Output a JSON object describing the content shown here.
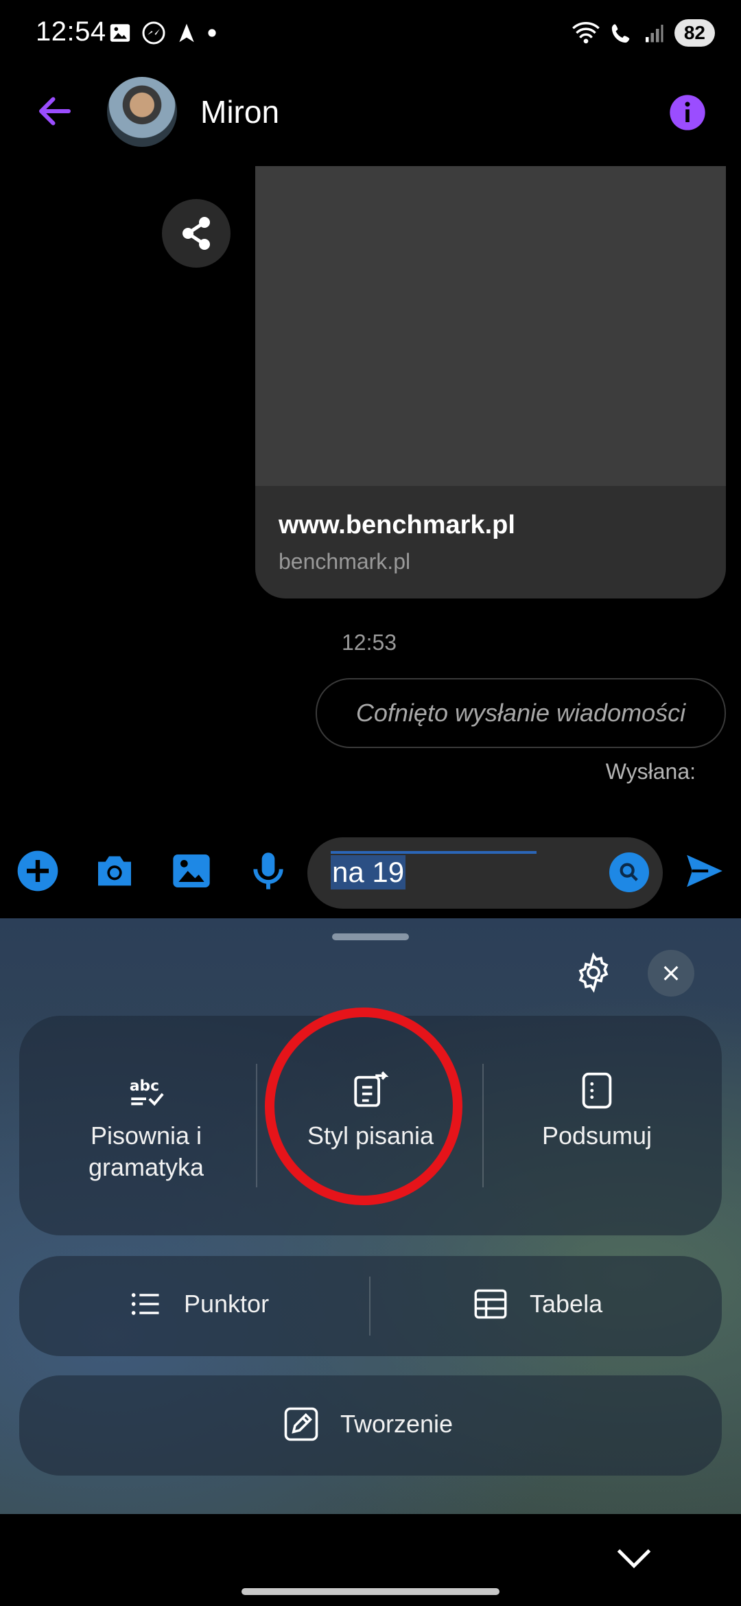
{
  "status_bar": {
    "time": "12:54",
    "battery": "82"
  },
  "header": {
    "contact_name": "Miron"
  },
  "chat": {
    "link_title": "www.benchmark.pl",
    "link_domain": "benchmark.pl",
    "timestamp": "12:53",
    "unsent_message": "Cofnięto wysłanie wiadomości",
    "sent_status": "Wysłana:"
  },
  "composer": {
    "input_value": "na 19"
  },
  "writing_assist": {
    "tools": [
      {
        "label": "Pisownia i gramatyka",
        "icon": "abc-check-icon"
      },
      {
        "label": "Styl pisania",
        "icon": "style-swap-icon"
      },
      {
        "label": "Podsumuj",
        "icon": "summary-icon"
      }
    ],
    "format": [
      {
        "label": "Punktor",
        "icon": "bullet-list-icon"
      },
      {
        "label": "Tabela",
        "icon": "table-icon"
      }
    ],
    "compose_label": "Tworzenie"
  },
  "colors": {
    "accent_purple": "#9b4dff",
    "messenger_blue": "#1e88e5",
    "highlight_red": "#e6141a"
  }
}
